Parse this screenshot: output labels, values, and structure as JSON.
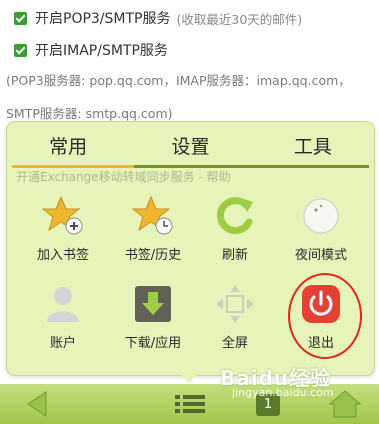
{
  "settings": {
    "pop3_option": "开启POP3/SMTP服务",
    "pop3_note": "(收取最近30天的邮件)",
    "imap_option": "开启IMAP/SMTP服务",
    "server_info_line1": "(POP3服务器: pop.qq.com，IMAP服务器：imap.qq.com，",
    "server_info_line2": "SMTP服务器: smtp.qq.com)",
    "exchange_option": "开通Exchange移动转域同步服务 - 帮助"
  },
  "menu": {
    "tabs": [
      {
        "label": "常用",
        "active": true
      },
      {
        "label": "设置",
        "active": false
      },
      {
        "label": "工具",
        "active": false
      }
    ],
    "items": [
      {
        "label": "加入书签",
        "icon": "add-bookmark-star-icon"
      },
      {
        "label": "书签/历史",
        "icon": "bookmark-history-star-icon"
      },
      {
        "label": "刷新",
        "icon": "refresh-icon"
      },
      {
        "label": "夜间模式",
        "icon": "night-mode-moon-icon"
      },
      {
        "label": "账户",
        "icon": "account-person-icon"
      },
      {
        "label": "下载/应用",
        "icon": "download-arrow-icon"
      },
      {
        "label": "全屏",
        "icon": "fullscreen-arrows-icon"
      },
      {
        "label": "退出",
        "icon": "power-exit-icon"
      }
    ]
  },
  "bottombar": {
    "page_count": "1",
    "watermark": "Baidu经验",
    "watermark_url": "jingyan.baidu.com"
  },
  "colors": {
    "menu_bg": "#e6f3b7",
    "tab_active_underline": "#e7b23a",
    "tab_underline": "#6f8f1d",
    "check_green": "#3d9b35",
    "exit_red": "#e0261b"
  }
}
